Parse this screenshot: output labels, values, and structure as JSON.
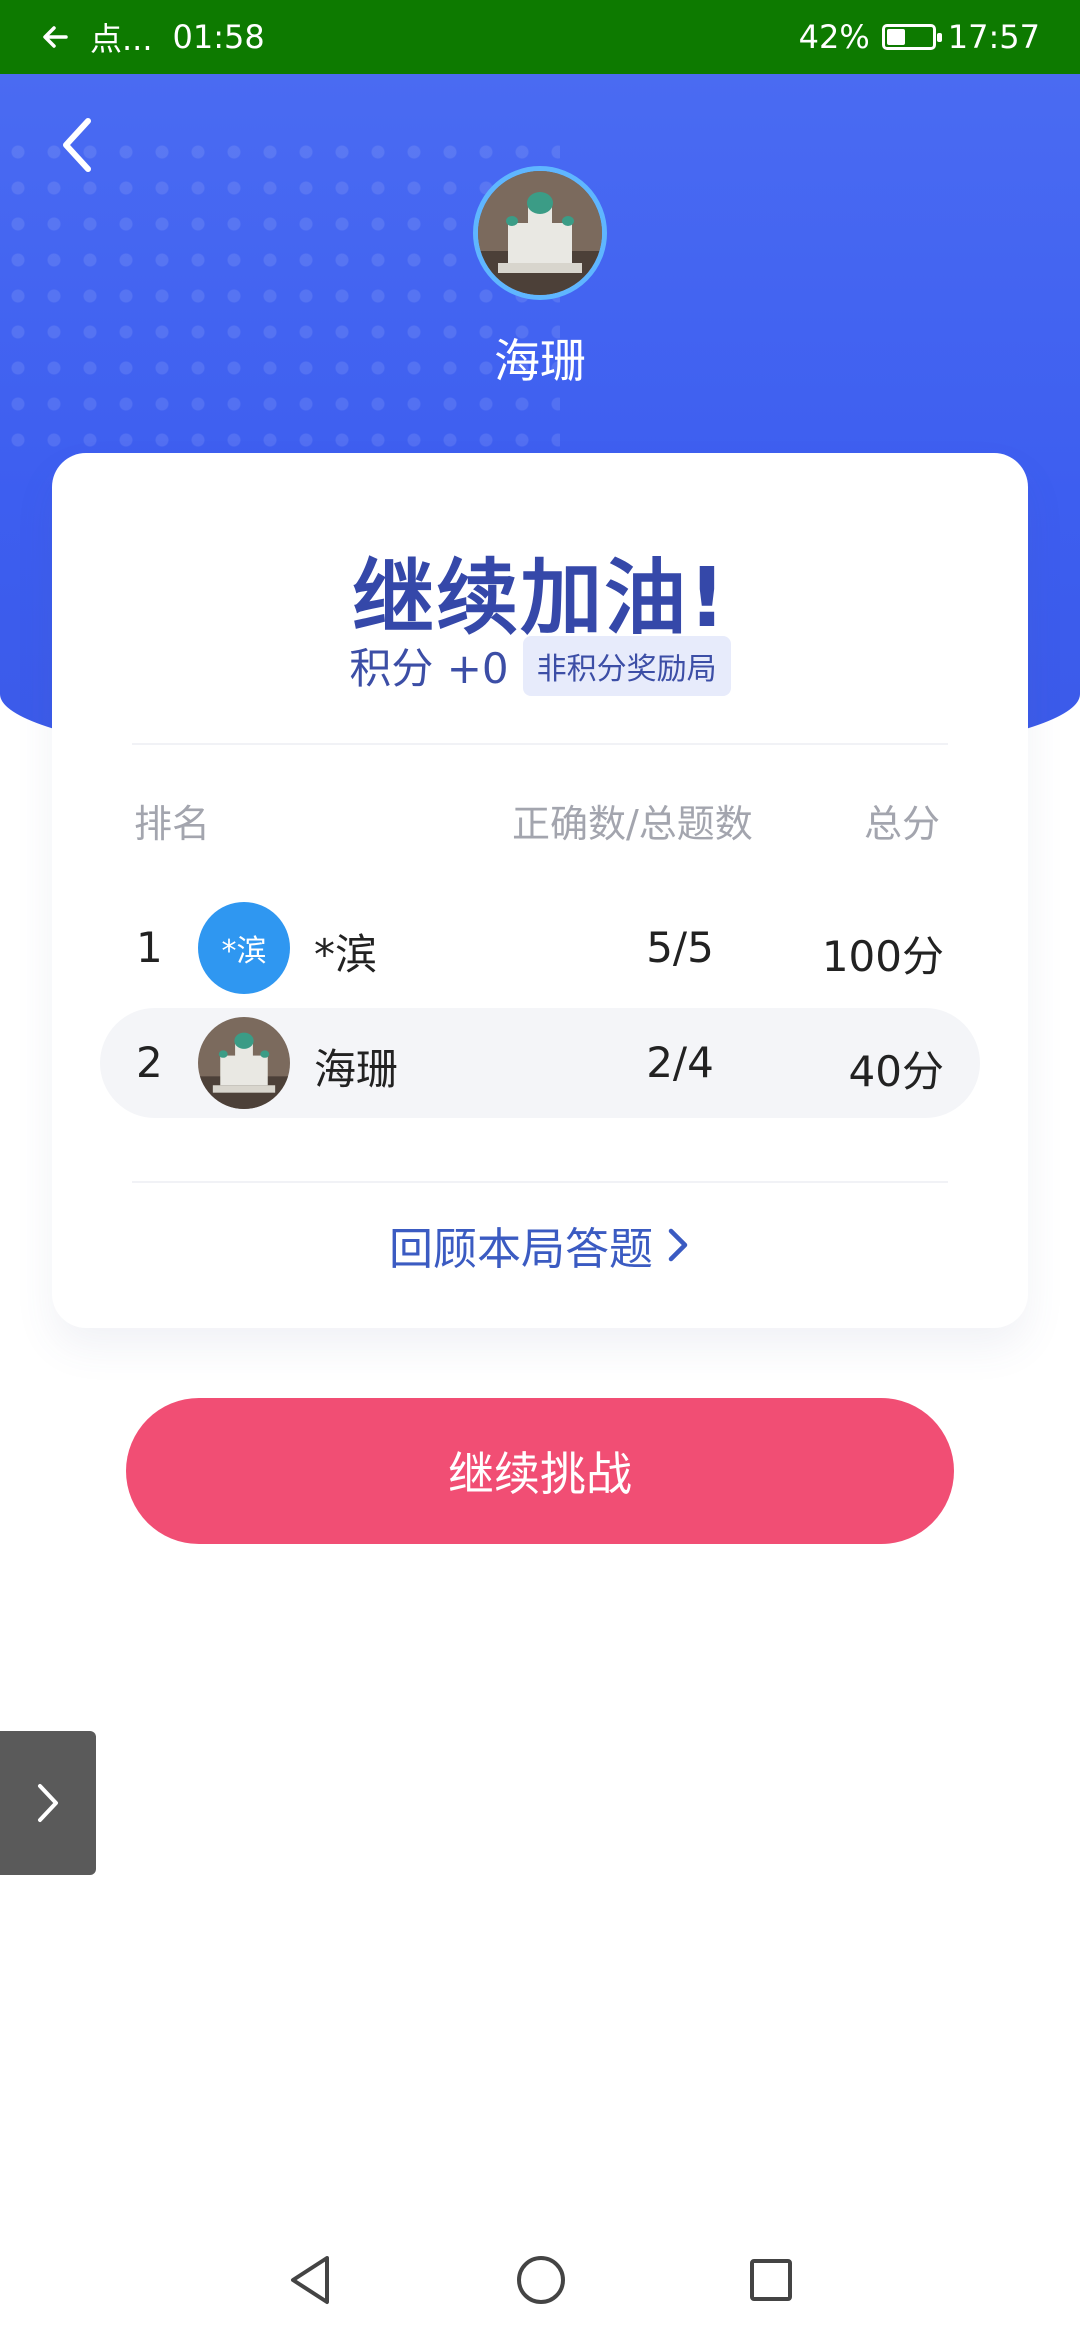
{
  "status_bar": {
    "app_short": "点...",
    "timer": "01:58",
    "battery_percent": "42%",
    "battery_level": 0.42,
    "clock": "17:57"
  },
  "hero": {
    "username": "海珊",
    "colors": {
      "background": "#3d5ef0",
      "avatar_ring": "#5fb6ff"
    }
  },
  "result_card": {
    "headline": "继续加油!",
    "score_label": "积分 +0",
    "tag": "非积分奖励局",
    "table": {
      "headers": {
        "rank": "排名",
        "ratio": "正确数/总题数",
        "total": "总分"
      },
      "rows": [
        {
          "rank": "1",
          "avatar_text": "*滨",
          "name": "*滨",
          "ratio": "5/5",
          "total": "100分"
        },
        {
          "rank": "2",
          "avatar_text": "",
          "name": "海珊",
          "ratio": "2/4",
          "total": "40分"
        }
      ]
    },
    "review_link": "回顾本局答题"
  },
  "cta": {
    "label": "继续挑战",
    "color": "#f14e74"
  },
  "icons": {
    "back": "chevron-left-icon",
    "review": "chevron-right-icon",
    "side_tab": "chevron-right-icon",
    "nav_back": "triangle-back-icon",
    "nav_home": "circle-home-icon",
    "nav_recent": "square-recent-icon"
  }
}
